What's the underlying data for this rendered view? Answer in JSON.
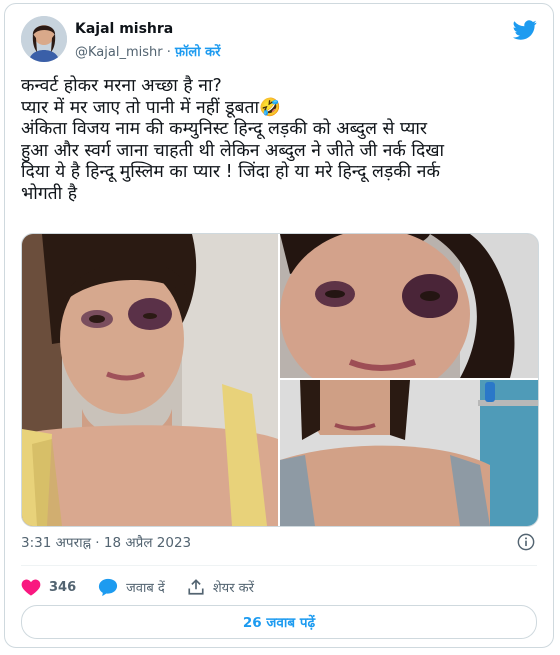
{
  "author": {
    "name": "Kajal mishra",
    "handle": "@Kajal_mishr",
    "separator": "·",
    "follow_label": "फ़ॉलो करें"
  },
  "tweet": {
    "lines": [
      "कन्वर्ट होकर मरना अच्छा है ना?",
      "प्यार में मर जाए तो पानी में नहीं डूबता🤣",
      "अंकिता विजय नाम की कम्युनिस्ट हिन्दू लड़की को अब्दुल से प्यार",
      "हुआ और स्वर्ग जाना चाहती थी लेकिन अब्दुल ने जीते जी नर्क दिखा",
      "दिया ये है हिन्दू मुस्लिम का प्यार ! जिंदा हो या मरे हिन्दू लड़की नर्क",
      "भोगती है"
    ]
  },
  "timestamp": "3:31 अपराह्न · 18 अप्रैल 2023",
  "actions": {
    "likes_count": "346",
    "reply_label": "जवाब दें",
    "share_label": "शेयर करें"
  },
  "replies_button": "26 जवाब पढ़ें",
  "colors": {
    "accent": "#1d9bf0",
    "like": "#f91880",
    "text": "#0f1419",
    "secondary": "#536471",
    "border": "#cfd9de"
  },
  "icons": [
    "twitter-bird-icon",
    "info-icon",
    "heart-icon",
    "reply-bubble-icon",
    "share-icon"
  ]
}
